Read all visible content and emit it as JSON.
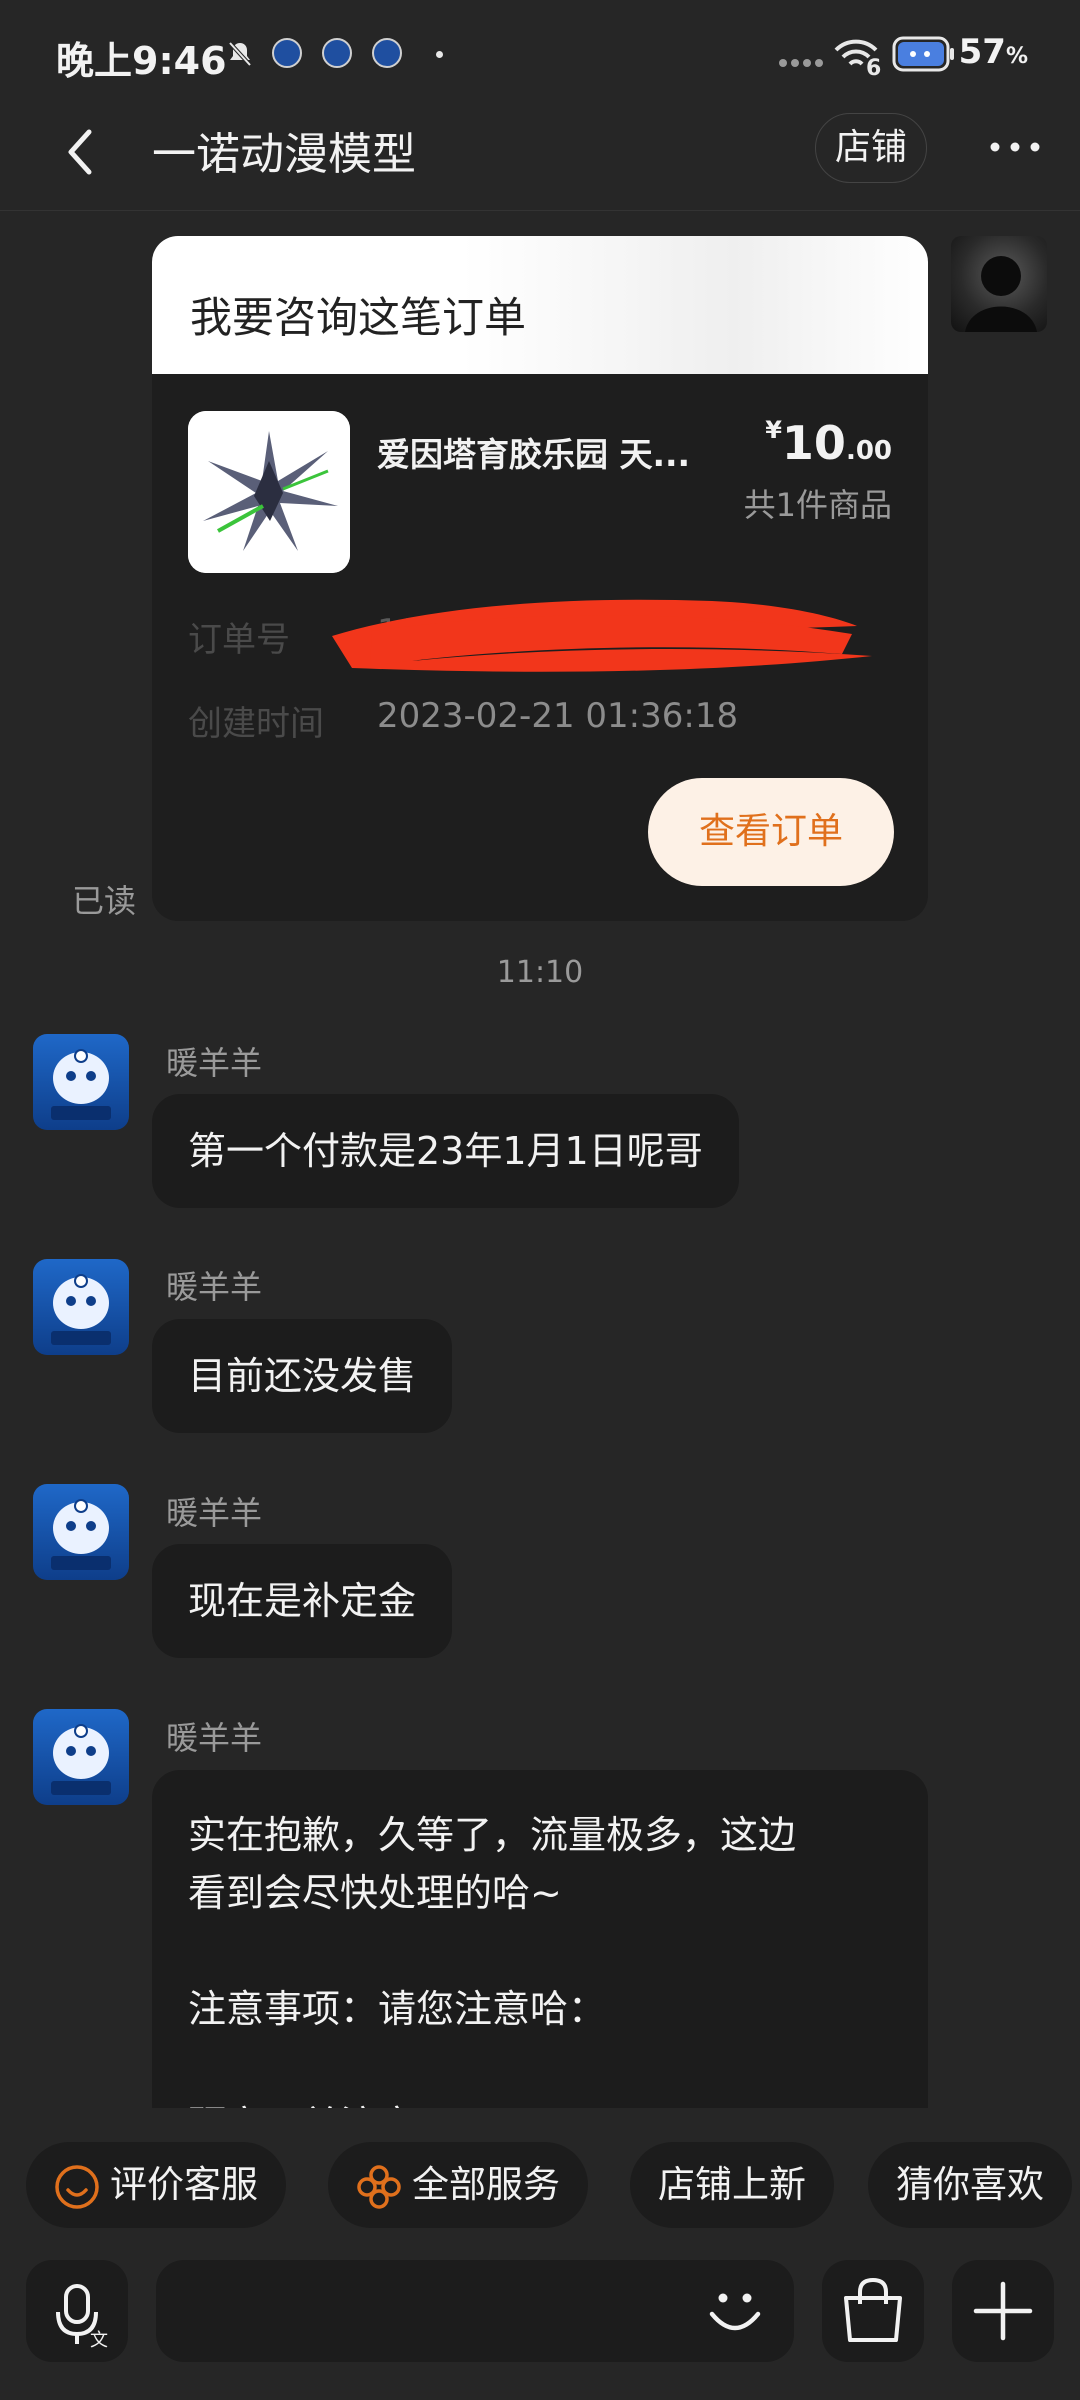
{
  "status_bar": {
    "time": "晚上9:46",
    "signal_badge": "6",
    "battery": "57",
    "battery_unit": "%"
  },
  "header": {
    "title": "一诺动漫模型",
    "shop_button": "店铺"
  },
  "order_card": {
    "title": "我要咨询这笔订单",
    "product_name": "爱因塔育胶乐园 天...",
    "price_symbol": "¥",
    "price_int": "10",
    "price_dec": ".00",
    "item_count": "共1件商品",
    "order_no_label": "订单号",
    "order_no_value": "18",
    "created_label": "创建时间",
    "created_value": "2023-02-21 01:36:18",
    "view_button": "查看订单"
  },
  "read_status": "已读",
  "time_separator": "11:10",
  "messages": [
    {
      "sender": "暖羊羊",
      "text": "第一个付款是23年1月1日呢哥"
    },
    {
      "sender": "暖羊羊",
      "text": "目前还没发售"
    },
    {
      "sender": "暖羊羊",
      "text": "现在是补定金"
    },
    {
      "sender": "暖羊羊",
      "line1": "实在抱歉，久等了，流量极多，这边",
      "line2": "看到会尽快处理的哈~",
      "line3": "注意事项：请您注意哈：",
      "line4": "预定下单注意"
    }
  ],
  "quick_actions": [
    "评价客服",
    "全部服务",
    "店铺上新",
    "猜你喜欢"
  ],
  "icons": {
    "accent_color": "#e0701c"
  }
}
